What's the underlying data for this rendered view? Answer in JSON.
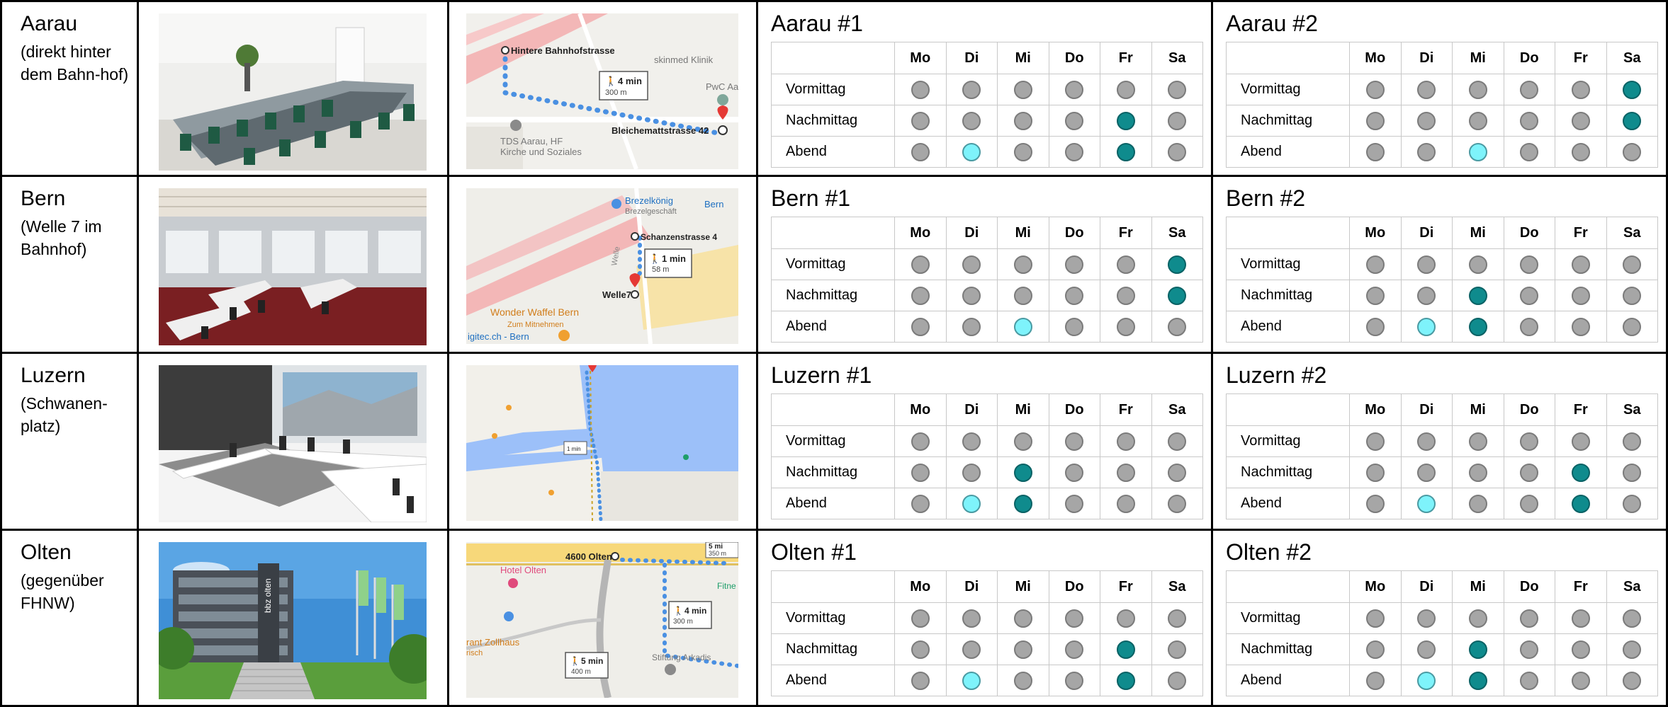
{
  "days": [
    "Mo",
    "Di",
    "Mi",
    "Do",
    "Fr",
    "Sa"
  ],
  "slot_labels": [
    "Vormittag",
    "Nachmittag",
    "Abend"
  ],
  "status_colors": {
    "grey": "#a6a6a6",
    "teal": "#0f8b8d",
    "light": "#7ef3fb"
  },
  "locations": [
    {
      "name": "Aarau",
      "sub": "(direkt hinter dem Bahn-hof)",
      "map": {
        "from": "Hintere Bahnhofstrasse",
        "to": "Bleichemattstrasse 42",
        "walk_time": "4 min",
        "walk_dist": "300 m",
        "poi_1": "skinmed Klinik",
        "poi_2": "PwC Aa",
        "poi_3": "TDS Aarau, HF",
        "poi_4": "Kirche und Soziales"
      },
      "schedules": [
        {
          "title": "Aarau #1",
          "rows": [
            [
              "grey",
              "grey",
              "grey",
              "grey",
              "grey",
              "grey"
            ],
            [
              "grey",
              "grey",
              "grey",
              "grey",
              "teal",
              "grey"
            ],
            [
              "grey",
              "light",
              "grey",
              "grey",
              "teal",
              "grey"
            ]
          ]
        },
        {
          "title": "Aarau #2",
          "rows": [
            [
              "grey",
              "grey",
              "grey",
              "grey",
              "grey",
              "teal"
            ],
            [
              "grey",
              "grey",
              "grey",
              "grey",
              "grey",
              "teal"
            ],
            [
              "grey",
              "grey",
              "light",
              "grey",
              "grey",
              "grey"
            ]
          ]
        }
      ]
    },
    {
      "name": "Bern",
      "sub": "(Welle 7 im Bahnhof)",
      "map": {
        "from": "Schanzenstrasse 4",
        "to": "Welle7",
        "walk_time": "1 min",
        "walk_dist": "58 m",
        "poi_1": "Brezelkönig",
        "poi_2": "Brezelgeschäft",
        "poi_3": "Wonder Waffel Bern",
        "poi_4": "Zum Mitnehmen",
        "poi_5": "igitec.ch - Bern",
        "poi_6": "Bern",
        "poi_7": "Welle"
      },
      "schedules": [
        {
          "title": "Bern #1",
          "rows": [
            [
              "grey",
              "grey",
              "grey",
              "grey",
              "grey",
              "teal"
            ],
            [
              "grey",
              "grey",
              "grey",
              "grey",
              "grey",
              "teal"
            ],
            [
              "grey",
              "grey",
              "light",
              "grey",
              "grey",
              "grey"
            ]
          ]
        },
        {
          "title": "Bern #2",
          "rows": [
            [
              "grey",
              "grey",
              "grey",
              "grey",
              "grey",
              "grey"
            ],
            [
              "grey",
              "grey",
              "teal",
              "grey",
              "grey",
              "grey"
            ],
            [
              "grey",
              "light",
              "teal",
              "grey",
              "grey",
              "grey"
            ]
          ]
        }
      ]
    },
    {
      "name": "Luzern",
      "sub": "(Schwanen-platz)",
      "map": {
        "walk_time": "1 min"
      },
      "schedules": [
        {
          "title": "Luzern #1",
          "rows": [
            [
              "grey",
              "grey",
              "grey",
              "grey",
              "grey",
              "grey"
            ],
            [
              "grey",
              "grey",
              "teal",
              "grey",
              "grey",
              "grey"
            ],
            [
              "grey",
              "light",
              "teal",
              "grey",
              "grey",
              "grey"
            ]
          ]
        },
        {
          "title": "Luzern #2",
          "rows": [
            [
              "grey",
              "grey",
              "grey",
              "grey",
              "grey",
              "grey"
            ],
            [
              "grey",
              "grey",
              "grey",
              "grey",
              "teal",
              "grey"
            ],
            [
              "grey",
              "light",
              "grey",
              "grey",
              "teal",
              "grey"
            ]
          ]
        }
      ]
    },
    {
      "name": "Olten",
      "sub": "(gegenüber FHNW)",
      "map": {
        "from": "4600 Olten",
        "walk_time": "4 min",
        "walk_dist": "300 m",
        "walk_time_2": "5 min",
        "walk_dist_2": "400 m",
        "walk_time_3": "5 mi",
        "walk_dist_3": "350 m",
        "poi_1": "Hotel Olten",
        "poi_2": "rant Zollhaus",
        "poi_3": "Stiftung Arkadis",
        "poi_4": "Fitne",
        "poi_5": "risch"
      },
      "schedules": [
        {
          "title": "Olten #1",
          "rows": [
            [
              "grey",
              "grey",
              "grey",
              "grey",
              "grey",
              "grey"
            ],
            [
              "grey",
              "grey",
              "grey",
              "grey",
              "teal",
              "grey"
            ],
            [
              "grey",
              "light",
              "grey",
              "grey",
              "teal",
              "grey"
            ]
          ]
        },
        {
          "title": "Olten #2",
          "rows": [
            [
              "grey",
              "grey",
              "grey",
              "grey",
              "grey",
              "grey"
            ],
            [
              "grey",
              "grey",
              "teal",
              "grey",
              "grey",
              "grey"
            ],
            [
              "grey",
              "light",
              "teal",
              "grey",
              "grey",
              "grey"
            ]
          ]
        }
      ]
    }
  ]
}
